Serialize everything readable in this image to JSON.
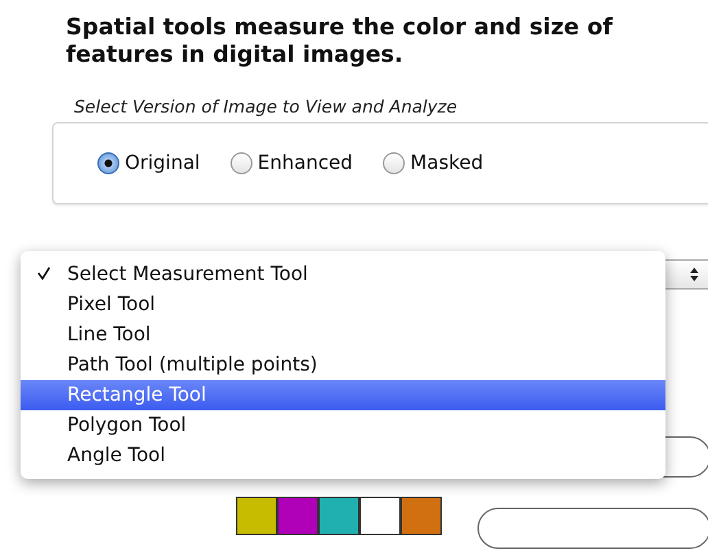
{
  "heading": "Spatial tools measure the color and size of features in digital images.",
  "version_group": {
    "label": "Select Version of Image to View and Analyze",
    "options": [
      {
        "label": "Original",
        "selected": true
      },
      {
        "label": "Enhanced",
        "selected": false
      },
      {
        "label": "Masked",
        "selected": false
      }
    ]
  },
  "tool_menu": {
    "items": [
      {
        "label": "Select Measurement Tool",
        "checked": true,
        "selected": false
      },
      {
        "label": "Pixel Tool",
        "checked": false,
        "selected": false
      },
      {
        "label": "Line Tool",
        "checked": false,
        "selected": false
      },
      {
        "label": "Path Tool (multiple points)",
        "checked": false,
        "selected": false
      },
      {
        "label": "Rectangle Tool",
        "checked": false,
        "selected": true
      },
      {
        "label": "Polygon Tool",
        "checked": false,
        "selected": false
      },
      {
        "label": "Angle Tool",
        "checked": false,
        "selected": false
      }
    ]
  },
  "swatches": [
    {
      "color": "#c8bc00"
    },
    {
      "color": "#b000b8"
    },
    {
      "color": "#20b0b0"
    },
    {
      "color": "#ffffff"
    },
    {
      "color": "#d07010"
    }
  ]
}
